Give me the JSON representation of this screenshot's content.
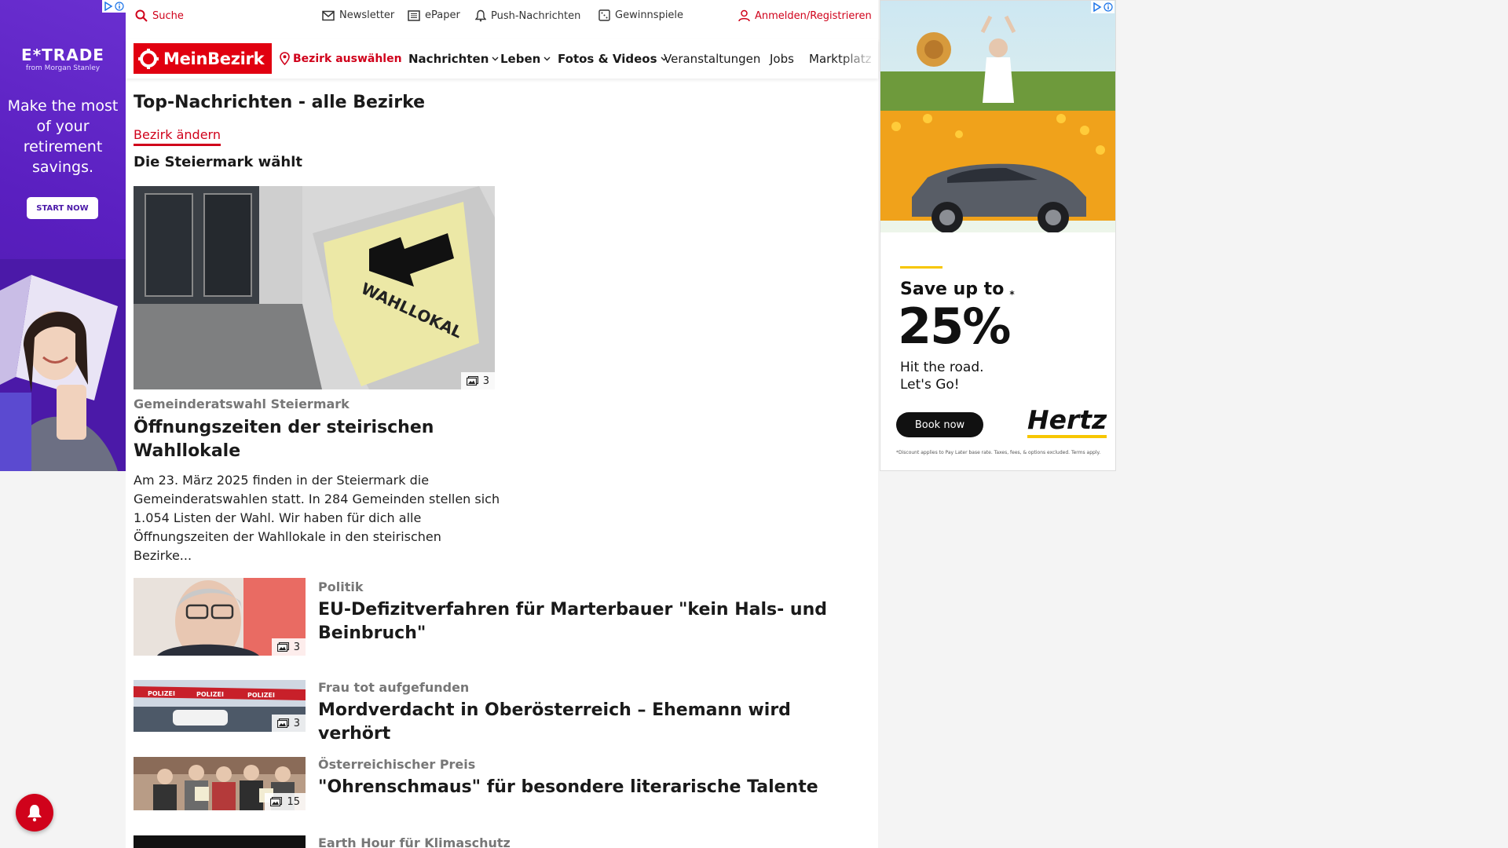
{
  "ad_left": {
    "brand": "E*TRADE",
    "brand_sub": "from Morgan Stanley",
    "headline": "Make the most of your retirement savings.",
    "cta": "START NOW"
  },
  "utility": {
    "search": "Suche",
    "newsletter": "Newsletter",
    "epaper": "ePaper",
    "push": "Push-Nachrichten",
    "contests": "Gewinnspiele",
    "login": "Anmelden/Registrieren"
  },
  "nav": {
    "logo": "MeinBezirk",
    "bezirk": "Bezirk auswählen",
    "items": [
      "Nachrichten",
      "Leben",
      "Fotos & Videos",
      "Veranstaltungen",
      "Jobs",
      "Marktplatz"
    ]
  },
  "main": {
    "page_title": "Top-Nachrichten - alle Bezirke",
    "change_link": "Bezirk ändern",
    "section_title": "Die Steiermark wählt",
    "hero": {
      "sign_text": "WAHLLOKAL",
      "image_count": "3",
      "kicker": "Gemeinderatswahl Steiermark",
      "title": "Öffnungszeiten der steirischen Wahllokale",
      "teaser": "Am 23. März 2025 finden in der Steiermark die Gemeinderatswahlen statt. In 284 Gemeinden stellen sich 1.054 Listen der Wahl. Wir haben für dich alle Öffnungszeiten der Wahllokale in den steirischen Bezirke..."
    },
    "articles": [
      {
        "kicker": "Politik",
        "title": "EU-Defizitverfahren für Marterbauer \"kein Hals- und Beinbruch\"",
        "image_count": "3"
      },
      {
        "kicker": "Frau tot aufgefunden",
        "title": "Mordverdacht in Oberösterreich – Ehemann wird verhört",
        "image_count": "3",
        "tape_text": "POLIZEI"
      },
      {
        "kicker": "Österreichischer Preis",
        "title": "\"Ohrenschmaus\" für besondere literarische Talente",
        "image_count": "15"
      },
      {
        "kicker": "Earth Hour für Klimaschutz",
        "title": "",
        "image_count": ""
      }
    ]
  },
  "ad_right": {
    "save": "Save up to",
    "percent": "25%",
    "percent_mark": "*",
    "line1": "Hit the road.",
    "line2": "Let's Go!",
    "cta": "Book now",
    "brand": "Hertz",
    "fine_print": "*Discount applies to Pay Later base rate. Taxes, fees, & options excluded. Terms apply."
  },
  "colors": {
    "brand_red": "#e10010",
    "link_red": "#d0021b",
    "etrade_purple": "#5a1fc0",
    "hertz_yellow": "#f7c600"
  }
}
